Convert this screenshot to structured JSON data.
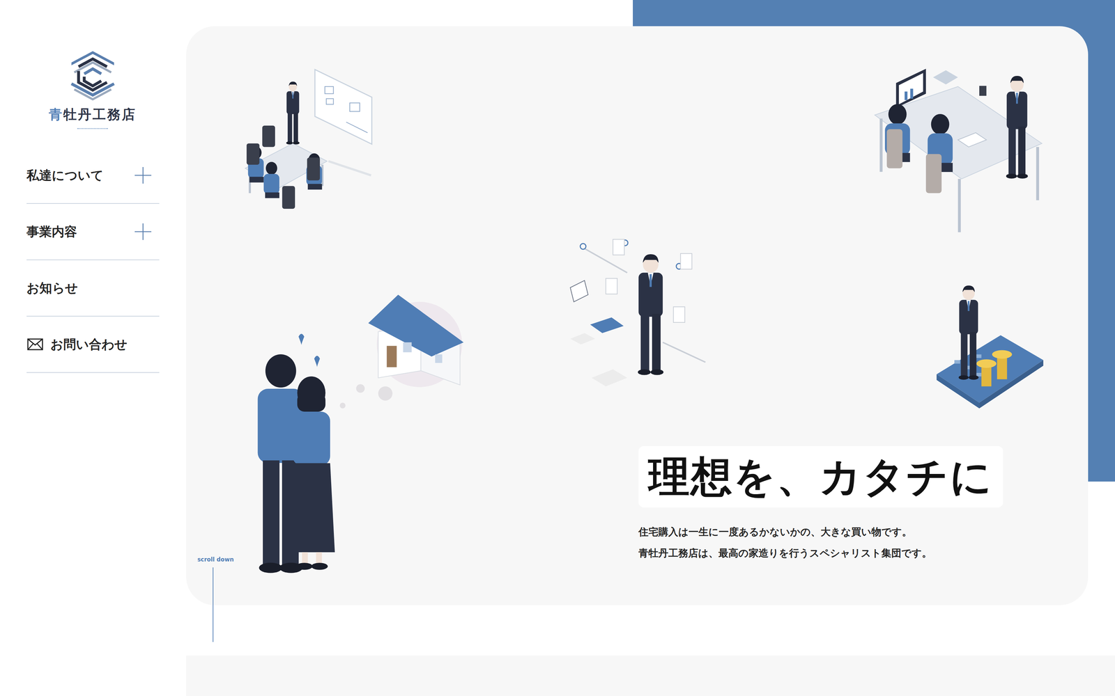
{
  "brand": {
    "accent": "青",
    "rest": "牡丹工務店"
  },
  "nav": [
    {
      "label": "私達について",
      "kind": "expandable",
      "expanded": false
    },
    {
      "label": "事業内容",
      "kind": "expandable",
      "expanded": false
    },
    {
      "label": "お知らせ",
      "kind": "link",
      "expanded": false
    },
    {
      "label": "お問い合わせ",
      "kind": "contact",
      "expanded": false
    }
  ],
  "hero": {
    "headline": "理想を、カタチに",
    "lines": [
      "住宅購入は一生に一度あるかないかの、大きな買い物です。",
      "青牡丹工務店は、最高の家造りを行うスペシャリスト集団です。"
    ]
  },
  "scroll": {
    "label": "scroll down"
  }
}
